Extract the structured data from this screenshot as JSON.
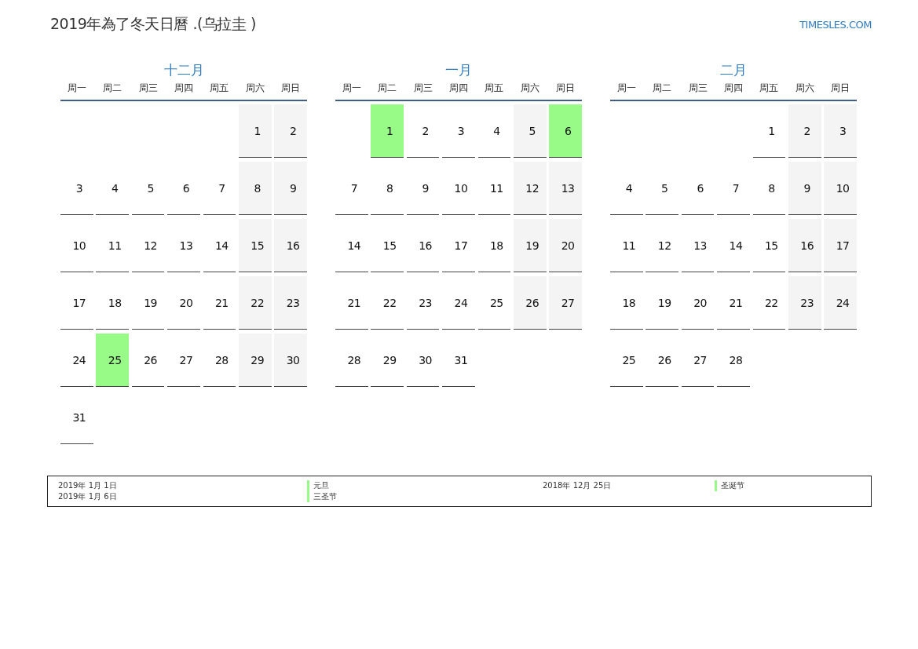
{
  "title": "2019年為了冬天日曆 .(乌拉圭 )",
  "site": "TIMESLES.COM",
  "months": [
    {
      "name": "十二月",
      "weekdays": [
        "周一",
        "周二",
        "周三",
        "周四",
        "周五",
        "周六",
        "周日"
      ],
      "weeks": [
        [
          {
            "kind": "blank"
          },
          {
            "kind": "blank"
          },
          {
            "kind": "blank"
          },
          {
            "kind": "blank"
          },
          {
            "kind": "blank"
          },
          {
            "day": "1",
            "kind": "weekend"
          },
          {
            "day": "2",
            "kind": "weekend"
          }
        ],
        [
          {
            "day": "3",
            "kind": "workday"
          },
          {
            "day": "4",
            "kind": "workday"
          },
          {
            "day": "5",
            "kind": "workday"
          },
          {
            "day": "6",
            "kind": "workday"
          },
          {
            "day": "7",
            "kind": "workday"
          },
          {
            "day": "8",
            "kind": "weekend"
          },
          {
            "day": "9",
            "kind": "weekend"
          }
        ],
        [
          {
            "day": "10",
            "kind": "workday"
          },
          {
            "day": "11",
            "kind": "workday"
          },
          {
            "day": "12",
            "kind": "workday"
          },
          {
            "day": "13",
            "kind": "workday"
          },
          {
            "day": "14",
            "kind": "workday"
          },
          {
            "day": "15",
            "kind": "weekend"
          },
          {
            "day": "16",
            "kind": "weekend"
          }
        ],
        [
          {
            "day": "17",
            "kind": "workday"
          },
          {
            "day": "18",
            "kind": "workday"
          },
          {
            "day": "19",
            "kind": "workday"
          },
          {
            "day": "20",
            "kind": "workday"
          },
          {
            "day": "21",
            "kind": "workday"
          },
          {
            "day": "22",
            "kind": "weekend"
          },
          {
            "day": "23",
            "kind": "weekend"
          }
        ],
        [
          {
            "day": "24",
            "kind": "workday"
          },
          {
            "day": "25",
            "kind": "holiday"
          },
          {
            "day": "26",
            "kind": "workday"
          },
          {
            "day": "27",
            "kind": "workday"
          },
          {
            "day": "28",
            "kind": "workday"
          },
          {
            "day": "29",
            "kind": "weekend"
          },
          {
            "day": "30",
            "kind": "weekend"
          }
        ],
        [
          {
            "day": "31",
            "kind": "workday"
          }
        ]
      ]
    },
    {
      "name": "一月",
      "weekdays": [
        "周一",
        "周二",
        "周三",
        "周四",
        "周五",
        "周六",
        "周日"
      ],
      "weeks": [
        [
          {
            "kind": "blank"
          },
          {
            "day": "1",
            "kind": "holiday"
          },
          {
            "day": "2",
            "kind": "workday"
          },
          {
            "day": "3",
            "kind": "workday"
          },
          {
            "day": "4",
            "kind": "workday"
          },
          {
            "day": "5",
            "kind": "weekend"
          },
          {
            "day": "6",
            "kind": "holiday"
          }
        ],
        [
          {
            "day": "7",
            "kind": "workday"
          },
          {
            "day": "8",
            "kind": "workday"
          },
          {
            "day": "9",
            "kind": "workday"
          },
          {
            "day": "10",
            "kind": "workday"
          },
          {
            "day": "11",
            "kind": "workday"
          },
          {
            "day": "12",
            "kind": "weekend"
          },
          {
            "day": "13",
            "kind": "weekend"
          }
        ],
        [
          {
            "day": "14",
            "kind": "workday"
          },
          {
            "day": "15",
            "kind": "workday"
          },
          {
            "day": "16",
            "kind": "workday"
          },
          {
            "day": "17",
            "kind": "workday"
          },
          {
            "day": "18",
            "kind": "workday"
          },
          {
            "day": "19",
            "kind": "weekend"
          },
          {
            "day": "20",
            "kind": "weekend"
          }
        ],
        [
          {
            "day": "21",
            "kind": "workday"
          },
          {
            "day": "22",
            "kind": "workday"
          },
          {
            "day": "23",
            "kind": "workday"
          },
          {
            "day": "24",
            "kind": "workday"
          },
          {
            "day": "25",
            "kind": "workday"
          },
          {
            "day": "26",
            "kind": "weekend"
          },
          {
            "day": "27",
            "kind": "weekend"
          }
        ],
        [
          {
            "day": "28",
            "kind": "workday"
          },
          {
            "day": "29",
            "kind": "workday"
          },
          {
            "day": "30",
            "kind": "workday"
          },
          {
            "day": "31",
            "kind": "workday"
          }
        ]
      ]
    },
    {
      "name": "二月",
      "weekdays": [
        "周一",
        "周二",
        "周三",
        "周四",
        "周五",
        "周六",
        "周日"
      ],
      "weeks": [
        [
          {
            "kind": "blank"
          },
          {
            "kind": "blank"
          },
          {
            "kind": "blank"
          },
          {
            "kind": "blank"
          },
          {
            "day": "1",
            "kind": "workday"
          },
          {
            "day": "2",
            "kind": "weekend"
          },
          {
            "day": "3",
            "kind": "weekend"
          }
        ],
        [
          {
            "day": "4",
            "kind": "workday"
          },
          {
            "day": "5",
            "kind": "workday"
          },
          {
            "day": "6",
            "kind": "workday"
          },
          {
            "day": "7",
            "kind": "workday"
          },
          {
            "day": "8",
            "kind": "workday"
          },
          {
            "day": "9",
            "kind": "weekend"
          },
          {
            "day": "10",
            "kind": "weekend"
          }
        ],
        [
          {
            "day": "11",
            "kind": "workday"
          },
          {
            "day": "12",
            "kind": "workday"
          },
          {
            "day": "13",
            "kind": "workday"
          },
          {
            "day": "14",
            "kind": "workday"
          },
          {
            "day": "15",
            "kind": "workday"
          },
          {
            "day": "16",
            "kind": "weekend"
          },
          {
            "day": "17",
            "kind": "weekend"
          }
        ],
        [
          {
            "day": "18",
            "kind": "workday"
          },
          {
            "day": "19",
            "kind": "workday"
          },
          {
            "day": "20",
            "kind": "workday"
          },
          {
            "day": "21",
            "kind": "workday"
          },
          {
            "day": "22",
            "kind": "workday"
          },
          {
            "day": "23",
            "kind": "weekend"
          },
          {
            "day": "24",
            "kind": "weekend"
          }
        ],
        [
          {
            "day": "25",
            "kind": "workday"
          },
          {
            "day": "26",
            "kind": "workday"
          },
          {
            "day": "27",
            "kind": "workday"
          },
          {
            "day": "28",
            "kind": "workday"
          }
        ]
      ]
    }
  ],
  "legend": [
    [
      {
        "date": "2019年 1月 1日",
        "name": "元旦",
        "color": "#98fb88"
      },
      {
        "date": "2019年 1月 6日",
        "name": "三圣节",
        "color": "#98fb88"
      }
    ],
    [
      {
        "date": "2018年 12月 25日",
        "name": "圣诞节",
        "color": "#98fb88"
      }
    ]
  ]
}
